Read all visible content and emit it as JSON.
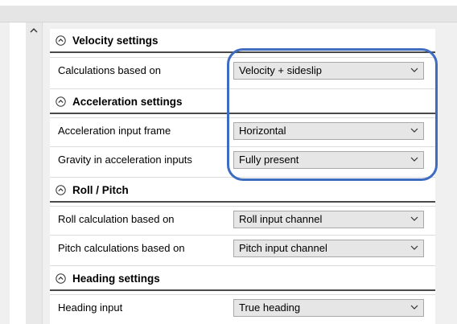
{
  "sections": [
    {
      "header": "Velocity settings",
      "rows": [
        {
          "label": "Calculations based on",
          "value": "Velocity + sideslip"
        }
      ]
    },
    {
      "header": "Acceleration settings",
      "rows": [
        {
          "label": "Acceleration input frame",
          "value": "Horizontal"
        },
        {
          "label": "Gravity in acceleration inputs",
          "value": "Fully present"
        }
      ]
    },
    {
      "header": "Roll / Pitch",
      "rows": [
        {
          "label": "Roll calculation based on",
          "value": "Roll input channel"
        },
        {
          "label": "Pitch calculations based on",
          "value": "Pitch input channel"
        }
      ]
    },
    {
      "header": "Heading settings",
      "rows": [
        {
          "label": "Heading input",
          "value": "True heading"
        }
      ]
    }
  ],
  "colors": {
    "highlight": "#3d6cc0"
  },
  "icons": {
    "collapse": "collapse-chevron-icon",
    "dropdown": "dropdown-chevron-icon",
    "scroll_up": "scroll-up-arrow-icon"
  }
}
